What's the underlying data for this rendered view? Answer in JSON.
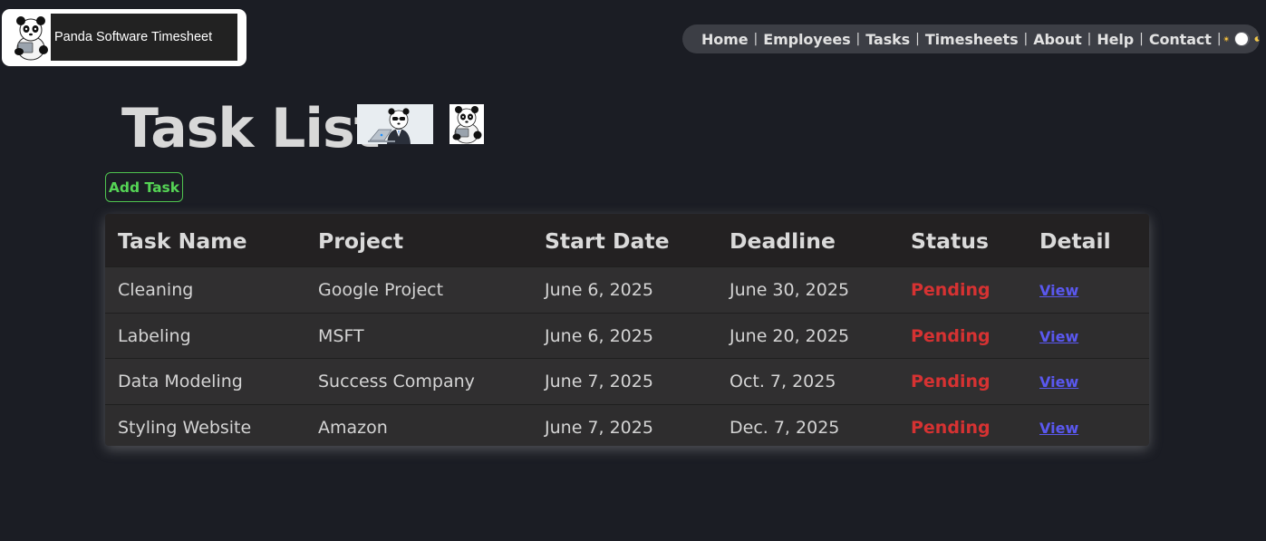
{
  "brand": {
    "title": "Panda Software Timesheet",
    "logo_icon": "panda-logo-icon"
  },
  "nav": {
    "items": [
      {
        "label": "Home"
      },
      {
        "label": "Employees"
      },
      {
        "label": "Tasks"
      },
      {
        "label": "Timesheets"
      },
      {
        "label": "About"
      },
      {
        "label": "Help"
      },
      {
        "label": "Contact"
      }
    ],
    "theme_toggle": {
      "light_icon": "sun-icon",
      "dark_icon": "moon-icon",
      "state": "dark"
    }
  },
  "page": {
    "title": "Task List",
    "title_images": [
      "panda-laptop-banner",
      "panda-laptop-small"
    ]
  },
  "actions": {
    "add_task_label": "Add Task"
  },
  "table": {
    "headers": [
      "Task Name",
      "Project",
      "Start Date",
      "Deadline",
      "Status",
      "Detail"
    ],
    "rows": [
      {
        "task": "Cleaning",
        "project": "Google Project",
        "start": "June 6, 2025",
        "deadline": "June 30, 2025",
        "status": "Pending",
        "detail": "View"
      },
      {
        "task": "Labeling",
        "project": "MSFT",
        "start": "June 6, 2025",
        "deadline": "June 20, 2025",
        "status": "Pending",
        "detail": "View"
      },
      {
        "task": "Data Modeling",
        "project": "Success Company",
        "start": "June 7, 2025",
        "deadline": "Oct. 7, 2025",
        "status": "Pending",
        "detail": "View"
      },
      {
        "task": "Styling Website",
        "project": "Amazon",
        "start": "June 7, 2025",
        "deadline": "Dec. 7, 2025",
        "status": "Pending",
        "detail": "View"
      }
    ]
  },
  "colors": {
    "background": "#1b1d24",
    "status_pending": "#d63232",
    "link": "#5a58f0",
    "add_button": "#55d455"
  }
}
